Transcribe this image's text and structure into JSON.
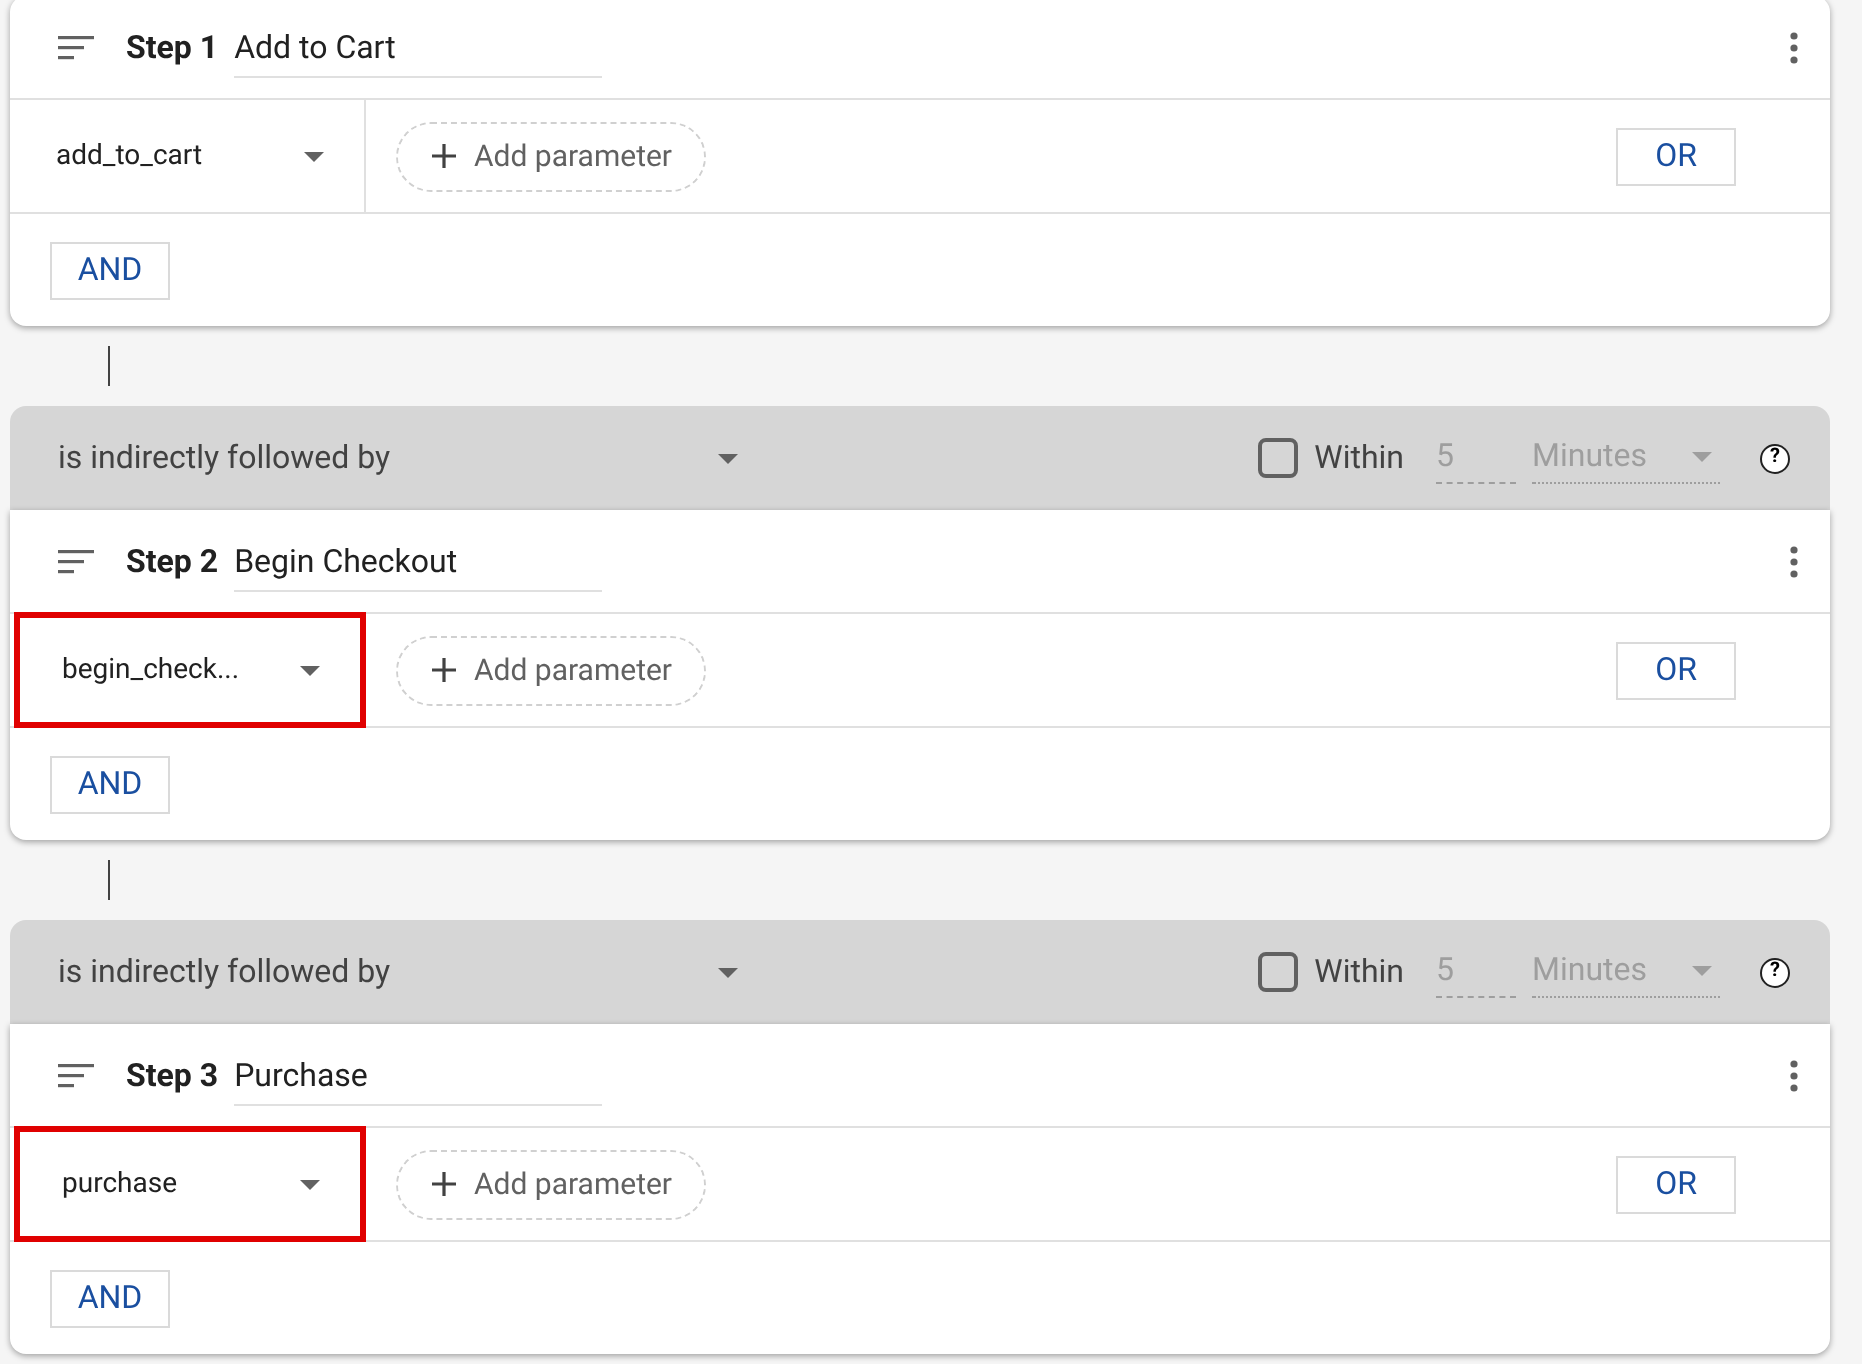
{
  "steps": [
    {
      "step_label": "Step 1",
      "name": "Add to Cart",
      "event": "add_to_cart",
      "highlighted": false,
      "add_parameter": "Add parameter",
      "or_button": "OR",
      "and_button": "AND"
    },
    {
      "connector": {
        "relation": "is indirectly followed by",
        "within_checked": false,
        "within_label": "Within",
        "within_value": "5",
        "unit": "Minutes",
        "help": "?"
      },
      "step_label": "Step 2",
      "name": "Begin Checkout",
      "event": "begin_check...",
      "highlighted": true,
      "add_parameter": "Add parameter",
      "or_button": "OR",
      "and_button": "AND"
    },
    {
      "connector": {
        "relation": "is indirectly followed by",
        "within_checked": false,
        "within_label": "Within",
        "within_value": "5",
        "unit": "Minutes",
        "help": "?"
      },
      "step_label": "Step 3",
      "name": "Purchase",
      "event": "purchase",
      "highlighted": true,
      "add_parameter": "Add parameter",
      "or_button": "OR",
      "and_button": "AND"
    }
  ]
}
